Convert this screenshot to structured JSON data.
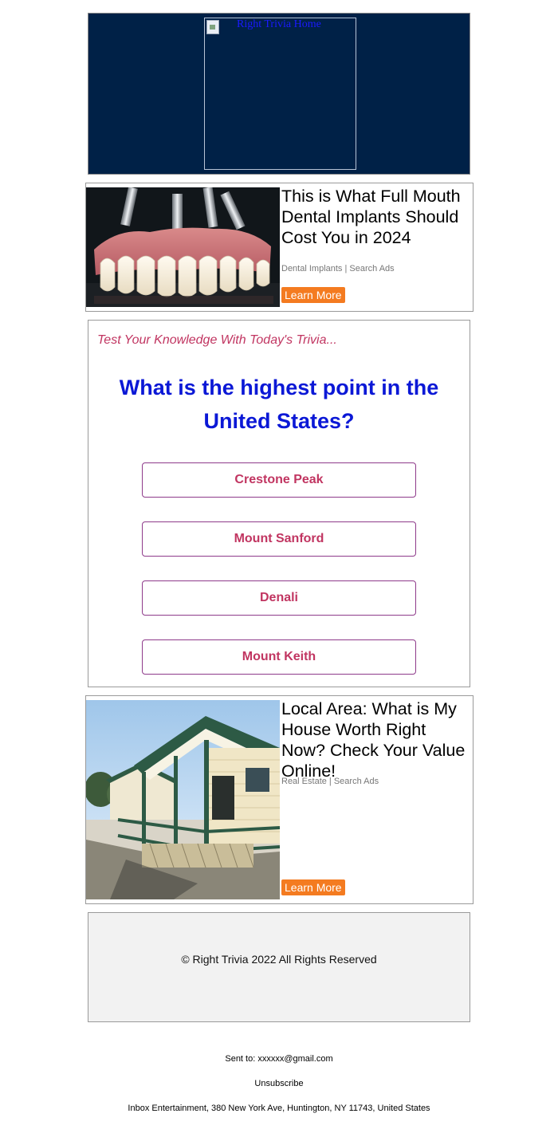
{
  "header": {
    "logo_alt": "Right Trivia Home",
    "background": "#002147"
  },
  "ads": [
    {
      "headline": "This is What Full Mouth Dental Implants Should Cost You in 2024",
      "source": "Dental Implants | Search Ads",
      "cta": "Learn More",
      "image": "dental-implants-photo"
    },
    {
      "headline": "Local Area: What is My House Worth Right Now? Check Your Value Online!",
      "source": "Real Estate | Search Ads",
      "cta": "Learn More",
      "image": "house-photo"
    }
  ],
  "trivia": {
    "intro": "Test Your Knowledge With Today's Trivia...",
    "question": "What is the highest point in the United States?",
    "answers": [
      "Crestone Peak",
      "Mount Sanford",
      "Denali",
      "Mount Keith"
    ]
  },
  "footer": {
    "copyright": "© Right Trivia 2022 All Rights Reserved",
    "sent_to": "Sent to: xxxxxx@gmail.com",
    "unsubscribe": "Unsubscribe",
    "address": "Inbox Entertainment, 380 New York Ave, Huntington, NY 11743, United States"
  },
  "colors": {
    "accent_orange": "#f47b20",
    "question_blue": "#0b18d6",
    "answer_pink": "#c13561"
  }
}
